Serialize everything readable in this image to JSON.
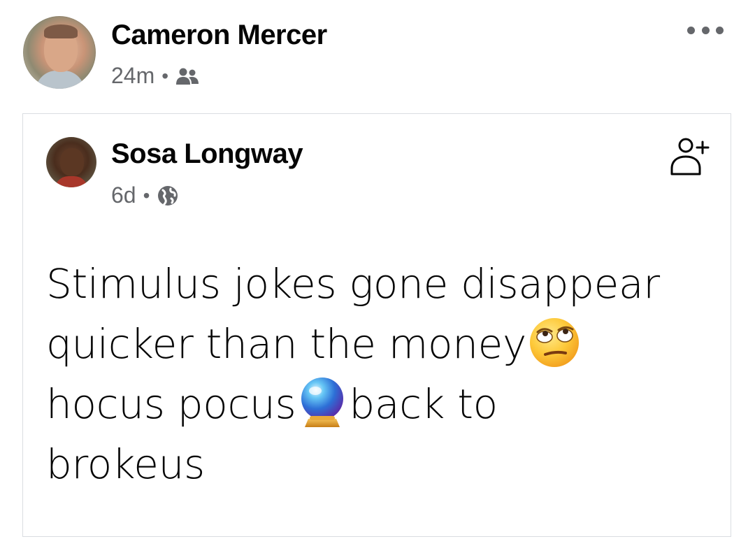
{
  "post": {
    "author": "Cameron Mercer",
    "time": "24m",
    "separator": "•",
    "audience_icon": "friends-icon",
    "more_icon": "more-options-icon"
  },
  "shared_post": {
    "author": "Sosa Longway",
    "time": "6d",
    "separator": "•",
    "audience_icon": "globe-icon",
    "add_friend_icon": "add-friend-icon",
    "text_lines": [
      {
        "before": "Stimulus jokes gone disappear",
        "emoji": "",
        "after": ""
      },
      {
        "before": "quicker than the money",
        "emoji": "face-with-rolling-eyes",
        "after": ""
      },
      {
        "before": "hocus pocus",
        "emoji": "crystal-ball",
        "after": "back to"
      },
      {
        "before": "brokeus",
        "emoji": "",
        "after": ""
      }
    ]
  },
  "colors": {
    "text": "#050505",
    "secondary_text": "#65676b",
    "border": "#dadde1"
  }
}
